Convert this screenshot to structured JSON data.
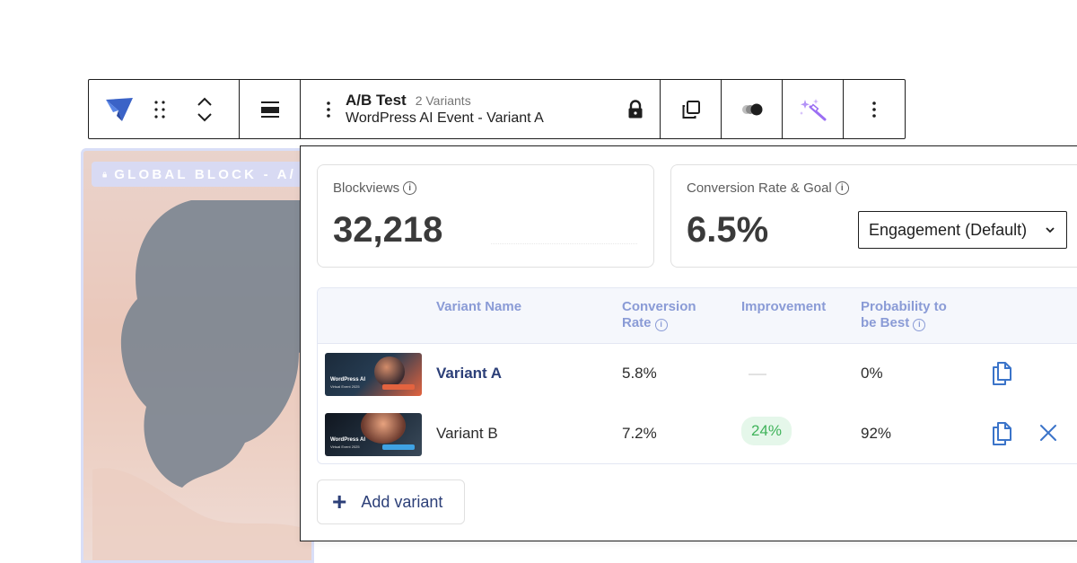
{
  "background": {
    "badge_label": "GLOBAL BLOCK - A/"
  },
  "toolbar": {
    "block_title": "A/B Test",
    "variants_count": "2 Variants",
    "subtitle": "WordPress AI Event - Variant A",
    "drag_glyph": "⠿",
    "kebab_glyph": "⋮"
  },
  "stats": {
    "blockviews_label": "Blockviews",
    "blockviews_value": "32,218",
    "conversion_label": "Conversion Rate & Goal",
    "conversion_value": "6.5%",
    "goal_selected": "Engagement (Default)"
  },
  "table": {
    "headers": {
      "name": "Variant Name",
      "conv_line1": "Conversion",
      "conv_line2": "Rate",
      "improvement": "Improvement",
      "prob_line1": "Probability to",
      "prob_line2": "be Best"
    },
    "rows": [
      {
        "name": "Variant A",
        "conversion_rate": "5.8%",
        "improvement": "",
        "probability": "0%",
        "thumb_title": "WordPress AI",
        "thumb_sub": "Virtual Event 2025"
      },
      {
        "name": "Variant B",
        "conversion_rate": "7.2%",
        "improvement": "24%",
        "probability": "92%",
        "thumb_title": "WordPress AI",
        "thumb_sub": "Virtual Event 2025"
      }
    ]
  },
  "add_variant_label": "Add variant",
  "colors": {
    "accent": "#2c3f78",
    "header_text": "#8a9bd6",
    "icon_blue": "#3b74c9",
    "improve_green": "#3fb35a",
    "improve_bg": "#e5f7ea",
    "magic_purple": "#9b6ef3"
  }
}
